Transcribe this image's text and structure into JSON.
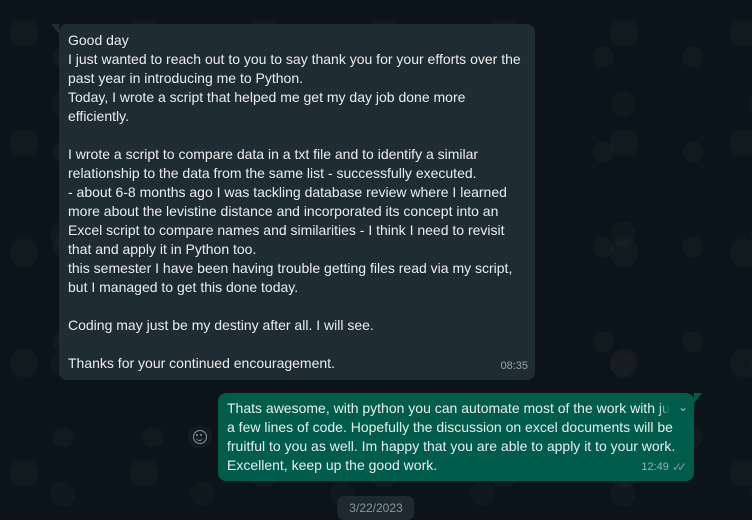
{
  "chat": {
    "date_top": "",
    "date_bottom": "3/22/2023",
    "incoming": {
      "text": "Good day\nI just wanted to reach out to you to say thank you for your efforts over the past year in introducing me to Python.\nToday, I wrote a script that helped me get my day job done more efficiently.\n\nI wrote a script to compare data in a txt file and to identify a similar relationship to the data from the same list - successfully executed.\n- about 6-8 months ago I was tackling database review where I learned more about the levistine distance and incorporated its concept into an Excel script to compare names and similarities - I think I need to revisit that and apply it in Python too.\nthis semester I have been having trouble getting files read via my script, but I managed to get this done today.\n\nCoding may just be my destiny after all. I will see.\n\nThanks for your continued encouragement.",
      "time": "08:35"
    },
    "outgoing": {
      "text": "Thats awesome, with python you can automate most of the work with just a few lines of code. Hopefully the discussion on excel documents will be fruitful to you as well. Im happy that you are able to apply it to your work. Excellent, keep up the good work.",
      "time": "12:49",
      "status_icon": "double-check-icon"
    }
  }
}
